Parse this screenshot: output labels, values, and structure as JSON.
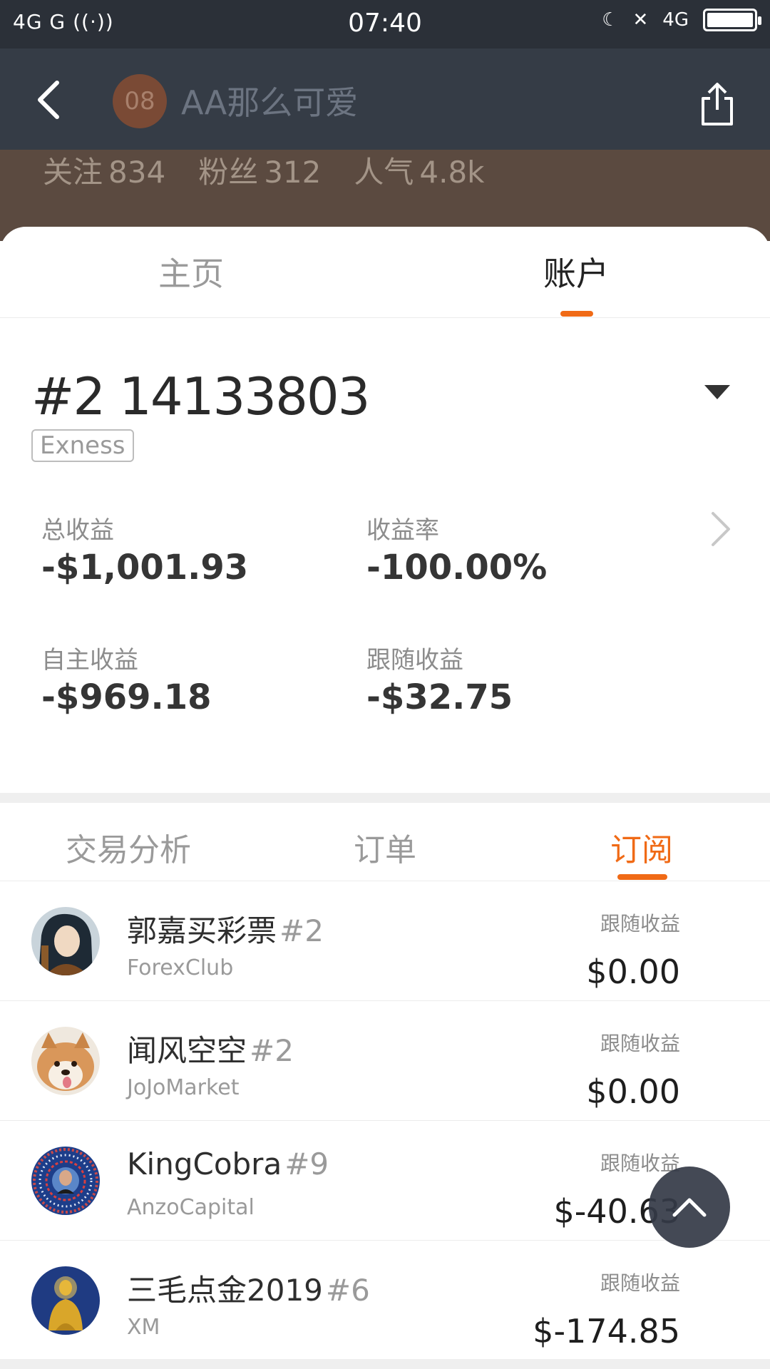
{
  "status_bar": {
    "left": "4G  G",
    "time": "07:40",
    "net": "4G"
  },
  "header": {
    "avatar_text": "08",
    "title": "AA那么可爱",
    "stats": [
      {
        "label": "关注",
        "value": "834"
      },
      {
        "label": "粉丝",
        "value": "312"
      },
      {
        "label": "人气",
        "value": "4.8k"
      }
    ]
  },
  "main_tabs": [
    "主页",
    "账户"
  ],
  "account": {
    "number": "#2 14133803",
    "broker": "Exness",
    "metrics": [
      {
        "label": "总收益",
        "value": "-$1,001.93"
      },
      {
        "label": "收益率",
        "value": "-100.00%"
      },
      {
        "label": "自主收益",
        "value": "-$969.18"
      },
      {
        "label": "跟随收益",
        "value": "-$32.75"
      }
    ]
  },
  "sub_tabs": [
    "交易分析",
    "订单",
    "订阅"
  ],
  "subscriptions": [
    {
      "name": "郭嘉买彩票",
      "rank": "#2",
      "broker": "ForexClub",
      "label": "跟随收益",
      "value": "$0.00",
      "avatar": "warrior-portrait"
    },
    {
      "name": "闻风空空",
      "rank": "#2",
      "broker": "JoJoMarket",
      "label": "跟随收益",
      "value": "$0.00",
      "avatar": "shiba-dog"
    },
    {
      "name": "KingCobra",
      "rank": "#9",
      "broker": "AnzoCapital",
      "label": "跟随收益",
      "value": "$-40.63",
      "avatar": "mandala-portrait"
    },
    {
      "name": "三毛点金2019",
      "rank": "#6",
      "broker": "XM",
      "label": "跟随收益",
      "value": "$-174.85",
      "avatar": "golden-buddha"
    }
  ],
  "colors": {
    "accent": "#f06a16",
    "app_bar": "#353c46",
    "status_bar": "#2b3038",
    "header_bg": "#5b4a40"
  }
}
